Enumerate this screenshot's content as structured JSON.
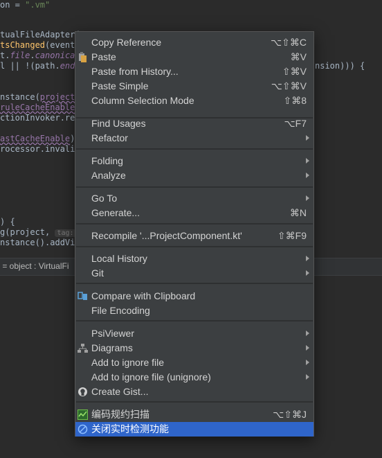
{
  "editor": {
    "lines": [
      {
        "parts": [
          {
            "t": "on = ",
            "c": "c-plain"
          },
          {
            "t": "\".vm\"",
            "c": "c-str"
          }
        ]
      },
      {
        "parts": [
          {
            "t": "tualFileAdapter(",
            "c": "c-plain"
          }
        ]
      },
      {
        "parts": [
          {
            "t": "tsChanged",
            "c": "c-fn"
          },
          {
            "t": "(event:",
            "c": "c-plain"
          }
        ]
      },
      {
        "parts": [
          {
            "t": "t.",
            "c": "c-plain"
          },
          {
            "t": "file",
            "c": "c-field"
          },
          {
            "t": ".",
            "c": "c-plain"
          },
          {
            "t": "canonical",
            "c": "c-field"
          }
        ]
      },
      {
        "parts": [
          {
            "t": "l || !(path.",
            "c": "c-plain"
          },
          {
            "t": "ends",
            "c": "c-field"
          }
        ]
      },
      {
        "parts": [
          {
            "t": "nstance(",
            "c": "c-plain"
          },
          {
            "t": "project",
            "c": "c-purple"
          },
          {
            "t": ")",
            "c": "c-plain"
          }
        ]
      },
      {
        "parts": [
          {
            "t": "ruleCacheEnable",
            "c": "c-purple"
          },
          {
            "t": ")",
            "c": "c-plain"
          }
        ]
      },
      {
        "parts": [
          {
            "t": "ctionInvoker.ref",
            "c": "c-plain"
          }
        ]
      },
      {
        "parts": [
          {
            "t": "astCacheEnable",
            "c": "c-purple"
          },
          {
            "t": ")",
            "c": "c-plain"
          }
        ]
      },
      {
        "parts": [
          {
            "t": "rocessor.invalid",
            "c": "c-plain"
          }
        ]
      },
      {
        "parts": [
          {
            "t": ") {",
            "c": "c-plain"
          }
        ]
      },
      {
        "parts": [
          {
            "t": "g(project, ",
            "c": "c-plain"
          },
          {
            "t": "tag:",
            "c": "c-hint"
          }
        ]
      },
      {
        "parts": [
          {
            "t": "nstance().addVir",
            "c": "c-plain"
          }
        ]
      }
    ],
    "fragment_right": "nsion))) {"
  },
  "status_bar": {
    "text": " = object : VirtualFi"
  },
  "context_menu": {
    "items": [
      {
        "label": "Copy Reference",
        "shortcut": "⌥⇧⌘C",
        "icon": "",
        "submenu": false
      },
      {
        "label": "Paste",
        "shortcut": "⌘V",
        "icon": "clipboard-icon",
        "submenu": false
      },
      {
        "label": "Paste from History...",
        "shortcut": "⇧⌘V",
        "icon": "",
        "submenu": false
      },
      {
        "label": "Paste Simple",
        "shortcut": "⌥⇧⌘V",
        "icon": "",
        "submenu": false
      },
      {
        "label": "Column Selection Mode",
        "shortcut": "⇧⌘8",
        "icon": "",
        "submenu": false
      },
      {
        "label": "Find Usages",
        "shortcut": "⌥F7",
        "icon": "",
        "submenu": false
      },
      {
        "label": "Refactor",
        "shortcut": "",
        "icon": "",
        "submenu": true
      },
      {
        "label": "Folding",
        "shortcut": "",
        "icon": "",
        "submenu": true
      },
      {
        "label": "Analyze",
        "shortcut": "",
        "icon": "",
        "submenu": true
      },
      {
        "label": "Go To",
        "shortcut": "",
        "icon": "",
        "submenu": true
      },
      {
        "label": "Generate...",
        "shortcut": "⌘N",
        "icon": "",
        "submenu": false
      },
      {
        "label": "Recompile '...ProjectComponent.kt'",
        "shortcut": "⇧⌘F9",
        "icon": "",
        "submenu": false
      },
      {
        "label": "Local History",
        "shortcut": "",
        "icon": "",
        "submenu": true
      },
      {
        "label": "Git",
        "shortcut": "",
        "icon": "",
        "submenu": true
      },
      {
        "label": "Compare with Clipboard",
        "shortcut": "",
        "icon": "compare-icon",
        "submenu": false
      },
      {
        "label": "File Encoding",
        "shortcut": "",
        "icon": "",
        "submenu": false
      },
      {
        "label": "PsiViewer",
        "shortcut": "",
        "icon": "",
        "submenu": true
      },
      {
        "label": "Diagrams",
        "shortcut": "",
        "icon": "diagram-icon",
        "submenu": true
      },
      {
        "label": "Add to ignore file",
        "shortcut": "",
        "icon": "",
        "submenu": true
      },
      {
        "label": "Add to ignore file (unignore)",
        "shortcut": "",
        "icon": "",
        "submenu": true
      },
      {
        "label": "Create Gist...",
        "shortcut": "",
        "icon": "github-icon",
        "submenu": false
      },
      {
        "label": "编码规约扫描",
        "shortcut": "⌥⇧⌘J",
        "icon": "scan-icon",
        "submenu": false
      },
      {
        "label": "关闭实时检测功能",
        "shortcut": "",
        "icon": "disable-icon",
        "submenu": false,
        "selected": true
      }
    ]
  },
  "colors": {
    "selection": "#2f65ca",
    "menu_bg": "#3c3f41",
    "editor_bg": "#2b2b2b"
  }
}
